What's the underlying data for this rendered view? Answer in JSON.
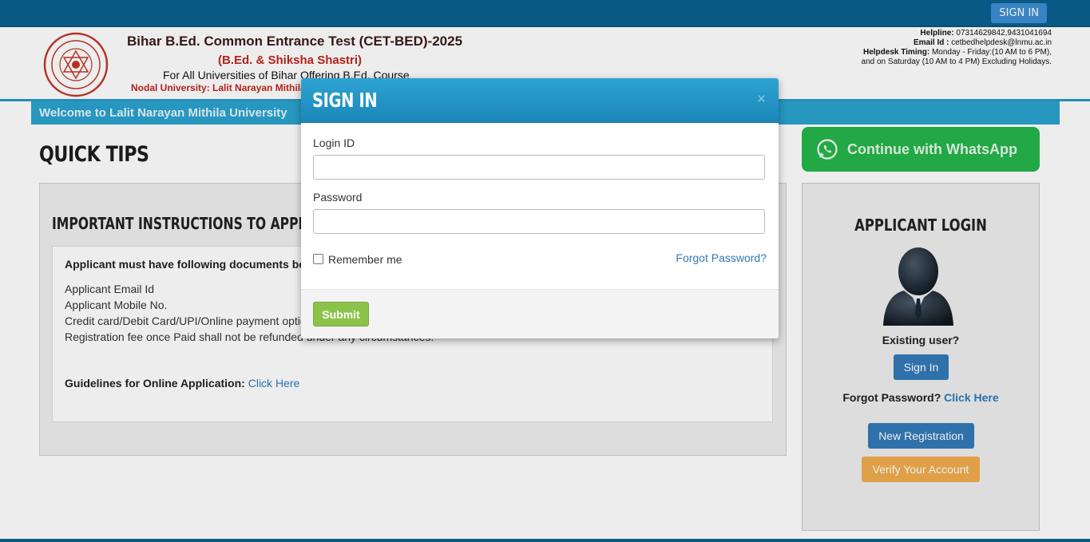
{
  "topbar": {
    "signin_label": "SIGN IN"
  },
  "header": {
    "title": "Bihar B.Ed. Common Entrance Test (CET-BED)-2025",
    "subtitle": "(B.Ed. & Shiksha Shastri)",
    "for_line": "For All Universities of Bihar Offering B.Ed. Course",
    "nodal": "Nodal University: Lalit Narayan Mithila University",
    "helpline_label": "Helpline:",
    "helpline_value": "07314629842,9431041694",
    "email_label": "Email Id :",
    "email_value": "cetbedhelpdesk@lnmu.ac.in",
    "timing_label": "Helpdesk Timing:",
    "timing_value": "Monday - Friday:(10 AM to 6 PM),",
    "timing_value2": "and on Saturday (10 AM to 4 PM) Excluding Holidays."
  },
  "welcome": "Welcome to Lalit Narayan Mithila University",
  "quick_tips": {
    "title": "QUICK TIPS",
    "panel_title": "IMPORTANT INSTRUCTIONS TO APPLICANT BEFORE APPLYING ONLINE",
    "requirement": "Applicant must have following documents before applying online:",
    "documents": [
      "Applicant Email Id",
      "Applicant Mobile No.",
      "Credit card/Debit Card/UPI/Online payment options",
      "Registration fee once Paid shall not be refunded under any circumstances."
    ],
    "guidelines_label": "Guidelines for Online Application:",
    "guidelines_link": "Click Here"
  },
  "whatsapp": {
    "label": "Continue with WhatsApp",
    "color": "#25b54a"
  },
  "applicant_login": {
    "title": "APPLICANT LOGIN",
    "existing_user": "Existing user?",
    "signin_button": "Sign In",
    "forgot_label": "Forgot Password?",
    "forgot_link": "Click Here",
    "new_registration": "New Registration",
    "verify_account": "Verify Your Account"
  },
  "modal": {
    "title": "SIGN IN",
    "close": "×",
    "login_label": "Login ID",
    "login_value": "",
    "password_label": "Password",
    "password_value": "",
    "remember_label": "Remember me",
    "forgot_password": "Forgot Password?",
    "submit": "Submit"
  }
}
